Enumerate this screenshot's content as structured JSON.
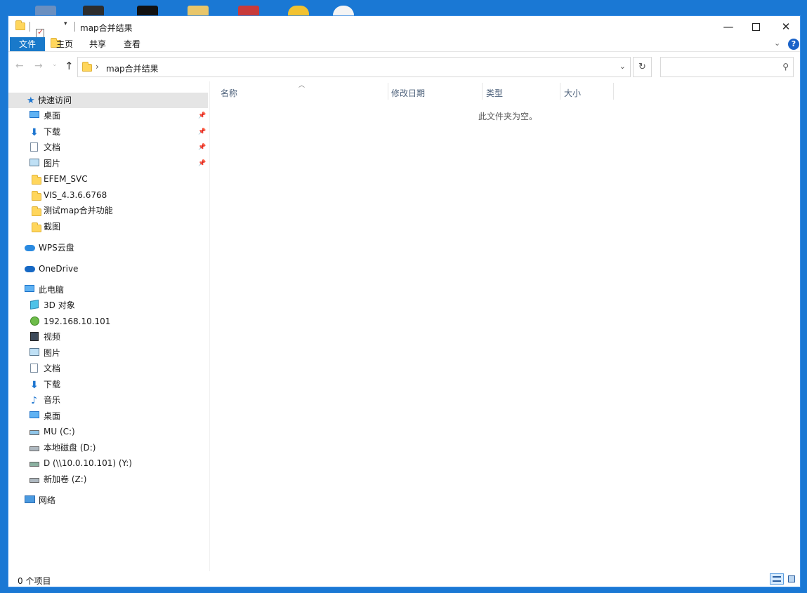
{
  "window": {
    "title": "map合并结果"
  },
  "ribbon": {
    "tabs": [
      "文件",
      "主页",
      "共享",
      "查看"
    ],
    "help_label": "?"
  },
  "address": {
    "path": "map合并结果",
    "separator": "›",
    "search_placeholder": ""
  },
  "nav_pane": {
    "quick_access": "快速访问",
    "quick_items": [
      "桌面",
      "下载",
      "文档",
      "图片",
      "EFEM_SVC",
      "VIS_4.3.6.6768",
      "测试map合并功能",
      "截图"
    ],
    "wps": "WPS云盘",
    "onedrive": "OneDrive",
    "this_pc": "此电脑",
    "pc_items": [
      "3D 对象",
      "192.168.10.101",
      "视频",
      "图片",
      "文档",
      "下载",
      "音乐",
      "桌面",
      "MU (C:)",
      "本地磁盘 (D:)",
      "D (\\\\10.0.10.101) (Y:)",
      "新加卷 (Z:)"
    ],
    "network": "网络"
  },
  "columns": [
    "名称",
    "修改日期",
    "类型",
    "大小"
  ],
  "content": {
    "empty_message": "此文件夹为空。"
  },
  "status": {
    "item_count": "0 个项目"
  },
  "icons": {
    "minimize": "minimize-icon",
    "maximize": "maximize-icon",
    "close": "close-icon"
  }
}
